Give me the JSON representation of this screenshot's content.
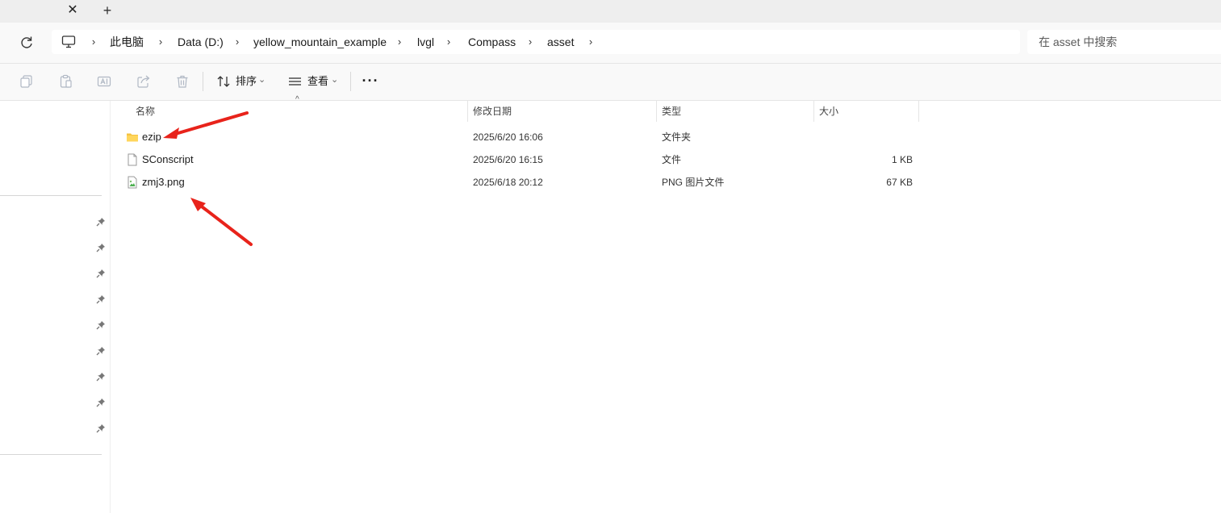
{
  "tabs": {
    "close_glyph": "✕",
    "new_glyph": "+"
  },
  "breadcrumb": [
    {
      "label": "此电脑"
    },
    {
      "label": "Data (D:)"
    },
    {
      "label": "yellow_mountain_example"
    },
    {
      "label": "lvgl"
    },
    {
      "label": "Compass"
    },
    {
      "label": "asset"
    }
  ],
  "search": {
    "placeholder": "在 asset 中搜索"
  },
  "toolbar": {
    "sort_label": "排序",
    "view_label": "查看",
    "more_glyph": "···",
    "chevron_glyph": "⌄"
  },
  "columns": {
    "name": "名称",
    "modified": "修改日期",
    "type": "类型",
    "size": "大小"
  },
  "files": [
    {
      "name": "ezip",
      "modified": "2025/6/20 16:06",
      "type": "文件夹",
      "size": "",
      "icon": "folder-icon"
    },
    {
      "name": "SConscript",
      "modified": "2025/6/20 16:15",
      "type": "文件",
      "size": "1 KB",
      "icon": "file-icon"
    },
    {
      "name": "zmj3.png",
      "modified": "2025/6/18 20:12",
      "type": "PNG 图片文件",
      "size": "67 KB",
      "icon": "image-file-icon"
    }
  ],
  "colors": {
    "accent_arrow": "#e8231b",
    "folder": "#f5c342",
    "background": "#ffffff",
    "chrome": "#f9f9f9"
  }
}
